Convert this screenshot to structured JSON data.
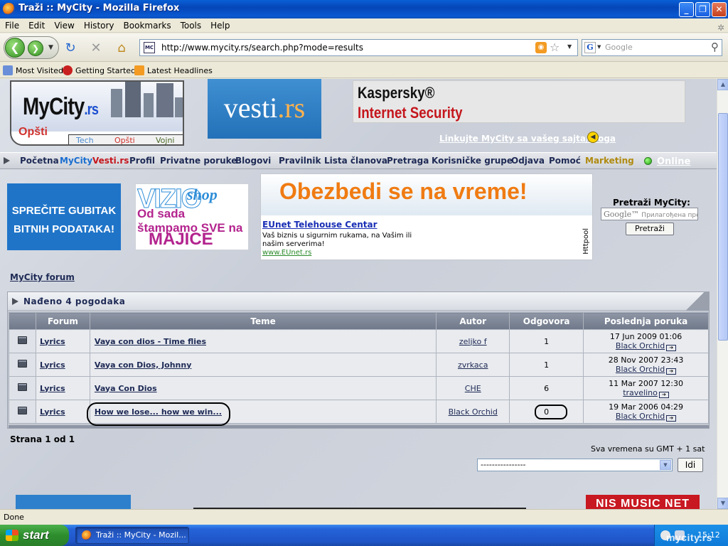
{
  "window": {
    "title": "Traži :: MyCity - Mozilla Firefox",
    "minimize": "_",
    "maximize": "❐",
    "close": "✕"
  },
  "menu": [
    "File",
    "Edit",
    "View",
    "History",
    "Bookmarks",
    "Tools",
    "Help"
  ],
  "toolbar": {
    "url": "http://www.mycity.rs/search.php?mode=results",
    "site_icon_label": "MC",
    "search_placeholder": "Google"
  },
  "bookmarks": [
    "Most Visited",
    "Getting Started",
    "Latest Headlines"
  ],
  "header": {
    "logo_name": "MyCity",
    "logo_tld": ".rs",
    "logo_section": "Opšti",
    "logo_tabs": [
      "Tech",
      "Opšti",
      "Vojni"
    ],
    "vesti_name": "vesti",
    "vesti_tld": ".rs",
    "kaspersky_line1": "Kaspersky®",
    "kaspersky_line2": "Internet Security",
    "link_text": "Linkujte MyCity sa vašeg sajta/bloga"
  },
  "nav": {
    "items": [
      "Početna",
      "MyCity",
      "Vesti.rs",
      "Profil",
      "Privatne poruke",
      "Blogovi",
      "Pravilnik",
      "Lista članova",
      "Pretraga",
      "Korisničke grupe",
      "Odjava",
      "Pomoć",
      "Marketing"
    ],
    "online": "Online",
    "colors": {
      "default": "#1e2a55",
      "mycity": "#1a6ed0",
      "vesti": "#c4161c",
      "marketing": "#b08a10"
    }
  },
  "ads": {
    "ad1_line1": "SPREČITE GUBITAK",
    "ad1_line2": "BITNIH PODATAKA!",
    "ad2_brand": "VIZIO",
    "ad2_shop": "shop",
    "ad2_line1": "Od sada",
    "ad2_line2": "štampamo SVE na",
    "ad2_line3": "MAJICE",
    "ad3_headline": "Obezbedi se na vreme!",
    "ad3_link": "EUnet Telehouse Centar",
    "ad3_text": "Vaš biznis u sigurnim rukama, na Vašim ili našim serverima!",
    "ad3_url": "www.EUnet.rs",
    "ad3_side": "Httpool"
  },
  "site_search": {
    "title": "Pretraži MyCity:",
    "google_label": "Google™",
    "placeholder": "Прилагођена претрага",
    "button": "Pretraži"
  },
  "breadcrumb": "MyCity forum",
  "results": {
    "title": "Nađeno 4 pogodaka",
    "columns": [
      "Forum",
      "Teme",
      "Autor",
      "Odgovora",
      "Poslednja poruka"
    ],
    "rows": [
      {
        "forum": "Lyrics",
        "topic": "Vaya con dios - Time flies",
        "author": "zeljko f",
        "replies": "1",
        "last_date": "17 Jun 2009 01:06",
        "last_user": "Black Orchid"
      },
      {
        "forum": "Lyrics",
        "topic": "Vaya con Dios, Johnny",
        "author": "zvrkaca",
        "replies": "1",
        "last_date": "28 Nov 2007 23:43",
        "last_user": "Black Orchid"
      },
      {
        "forum": "Lyrics",
        "topic": "Vaya Con Dios",
        "author": "CHE",
        "replies": "6",
        "last_date": "11 Mar 2007 12:30",
        "last_user": "travelino"
      },
      {
        "forum": "Lyrics",
        "topic": "How we lose... how we win...",
        "author": "Black Orchid",
        "replies": "0",
        "last_date": "19 Mar 2006 04:29",
        "last_user": "Black Orchid"
      }
    ]
  },
  "pagination": "Strana 1 od 1",
  "timezone": "Sva vremena su GMT + 1 sat",
  "jump": {
    "selected": "----------------",
    "button": "Idi"
  },
  "bottom_ad": "NIS MUSIC NET",
  "status": "Done",
  "taskbar": {
    "start": "start",
    "task": "Traži :: MyCity - Mozil...",
    "clock": "15:12",
    "watermark": "mycity.rs"
  }
}
